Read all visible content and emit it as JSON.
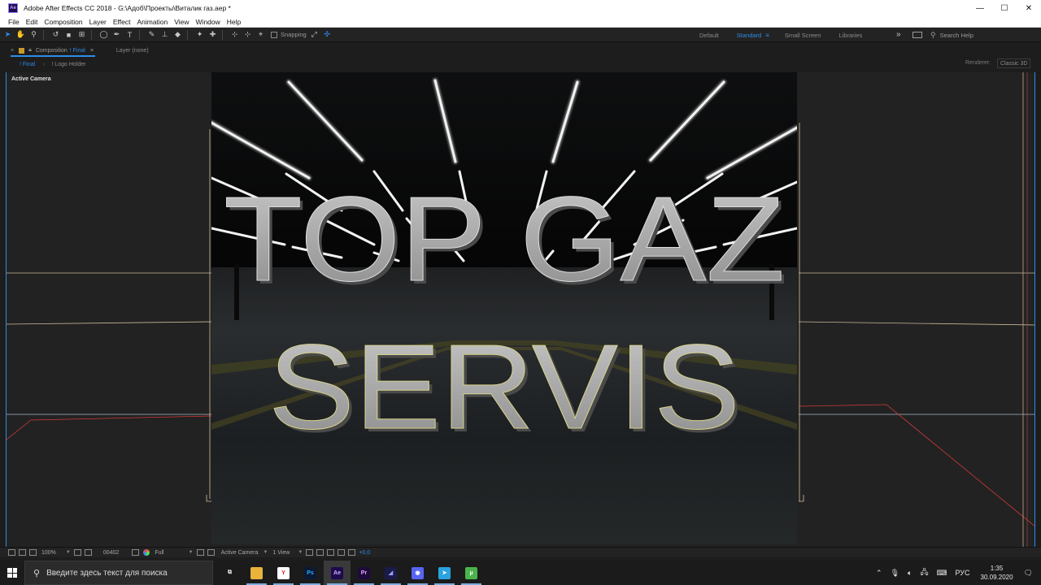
{
  "window": {
    "app_badge": "Ae",
    "title": "Adobe After Effects CC 2018 - G:\\Адоб\\Проекты\\Виталик газ.aep *",
    "minimize": "—",
    "maximize": "☐",
    "close": "✕"
  },
  "menu": [
    "File",
    "Edit",
    "Composition",
    "Layer",
    "Effect",
    "Animation",
    "View",
    "Window",
    "Help"
  ],
  "toolbar": {
    "snapping_label": "Snapping",
    "workspaces": [
      "Default",
      "Standard",
      "Small Screen",
      "Libraries"
    ],
    "active_workspace": "Standard",
    "more": "»",
    "search_placeholder": "Search Help"
  },
  "panel": {
    "close": "×",
    "composition_prefix": "Composition",
    "composition_name": "! Final",
    "menu_glyph": "≡",
    "layer_tab": "Layer  (none)",
    "subtabs": [
      "! Final",
      "! Logo Holder"
    ],
    "subtab_arrow": "‹",
    "renderer_label": "Renderer:",
    "renderer_value": "Classic 3D"
  },
  "viewer": {
    "view_label": "Active Camera",
    "scene_line1": "TOP GAZ",
    "scene_line2": "SERVIS"
  },
  "viewer_bar": {
    "zoom": "100%",
    "timecode": "00402",
    "resolution": "Full",
    "camera": "Active Camera",
    "views": "1 View",
    "exposure": "+0,0"
  },
  "taskbar": {
    "search_placeholder": "Введите здесь текст для поиска",
    "apps": [
      {
        "name": "task-view",
        "label": "⧉",
        "bg": "transparent",
        "fg": "#e6e6e6"
      },
      {
        "name": "file-explorer",
        "label": "▬",
        "bg": "#e8b33a",
        "fg": "#e8b33a"
      },
      {
        "name": "yandex-browser",
        "label": "Y",
        "bg": "#ffffff",
        "fg": "#e02020"
      },
      {
        "name": "photoshop",
        "label": "Ps",
        "bg": "#0b1a33",
        "fg": "#31a8ff"
      },
      {
        "name": "after-effects",
        "label": "Ae",
        "bg": "#1f0a4d",
        "fg": "#c7b4ff"
      },
      {
        "name": "premiere-pro",
        "label": "Pr",
        "bg": "#1e0a3a",
        "fg": "#e6a6ff"
      },
      {
        "name": "media-encoder",
        "label": "◢",
        "bg": "#1a1a4a",
        "fg": "#9aa0ff"
      },
      {
        "name": "discord",
        "label": "◉",
        "bg": "#5865f2",
        "fg": "#ffffff"
      },
      {
        "name": "telegram",
        "label": "➤",
        "bg": "#2aa3e0",
        "fg": "#ffffff"
      },
      {
        "name": "utorrent",
        "label": "µ",
        "bg": "#4bb34b",
        "fg": "#ffffff"
      }
    ],
    "active_app": "after-effects",
    "language": "РУС",
    "time": "1:35",
    "date": "30.09.2020"
  }
}
